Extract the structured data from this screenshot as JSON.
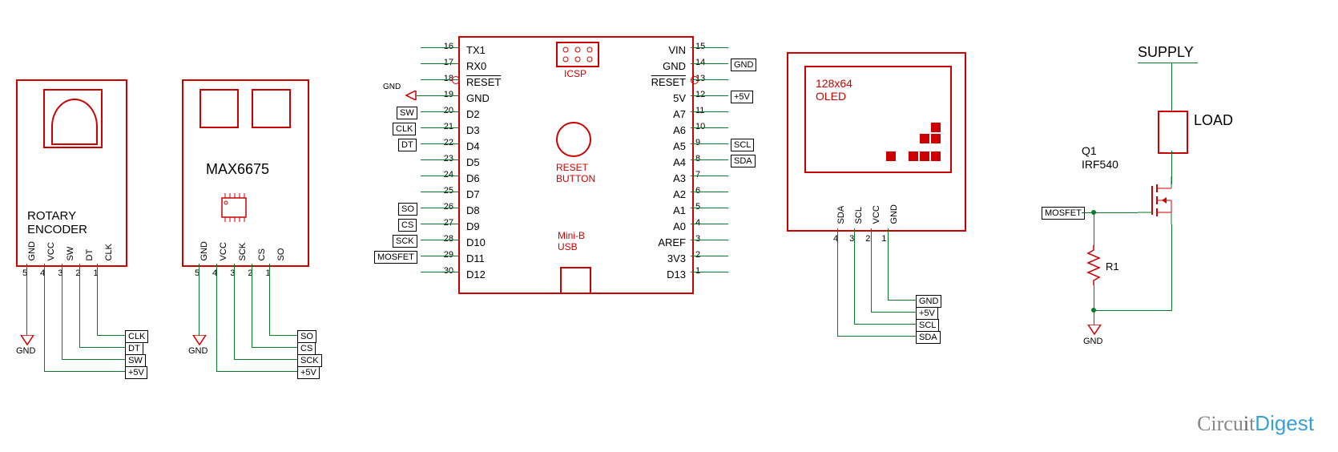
{
  "rotary": {
    "title": "ROTARY\nENCODER",
    "pins": [
      "GND",
      "VCC",
      "SW",
      "DT",
      "CLK"
    ],
    "nums": [
      "5",
      "4",
      "3",
      "2",
      "1"
    ],
    "nets": [
      "CLK",
      "DT",
      "SW",
      "+5V"
    ],
    "gnd": "GND"
  },
  "max6675": {
    "title": "MAX6675",
    "pins": [
      "GND",
      "VCC",
      "SCK",
      "CS",
      "SO"
    ],
    "nums": [
      "5",
      "4",
      "3",
      "2",
      "1"
    ],
    "nets": [
      "SO",
      "CS",
      "SCK",
      "+5V"
    ],
    "gnd": "GND"
  },
  "arduino": {
    "icsp": "ICSP",
    "reset": "RESET\nBUTTON",
    "usb": "Mini-B\nUSB",
    "left_nums": [
      "16",
      "17",
      "18",
      "19",
      "20",
      "21",
      "22",
      "23",
      "24",
      "25",
      "26",
      "27",
      "28",
      "29",
      "30"
    ],
    "left_labels": [
      "TX1",
      "RX0",
      "RESET",
      "GND",
      "D2",
      "D3",
      "D4",
      "D5",
      "D6",
      "D7",
      "D8",
      "D9",
      "D10",
      "D11",
      "D12"
    ],
    "right_labels": [
      "VIN",
      "GND",
      "RESET",
      "5V",
      "A7",
      "A6",
      "A5",
      "A4",
      "A3",
      "A2",
      "A1",
      "A0",
      "AREF",
      "3V3",
      "D13"
    ],
    "right_nums": [
      "15",
      "14",
      "13",
      "12",
      "11",
      "10",
      "9",
      "8",
      "7",
      "6",
      "5",
      "4",
      "3",
      "2",
      "1"
    ],
    "left_nets": {
      "gnd": "GND",
      "sw": "SW",
      "clk": "CLK",
      "dt": "DT",
      "so": "SO",
      "cs": "CS",
      "sck": "SCK",
      "mosfet": "MOSFET"
    },
    "right_nets": {
      "gnd": "GND",
      "v5": "+5V",
      "scl": "SCL",
      "sda": "SDA"
    }
  },
  "oled": {
    "title": "128x64\nOLED",
    "pins": [
      "SDA",
      "SCL",
      "VCC",
      "GND"
    ],
    "nums": [
      "4",
      "3",
      "2",
      "1"
    ],
    "nets": [
      "GND",
      "+5V",
      "SCL",
      "SDA"
    ]
  },
  "mosfet": {
    "supply": "SUPPLY",
    "load": "LOAD",
    "q": "Q1",
    "part": "IRF540",
    "net": "MOSFET",
    "r": "R1",
    "gnd": "GND"
  },
  "watermark": "CircuitDigest"
}
